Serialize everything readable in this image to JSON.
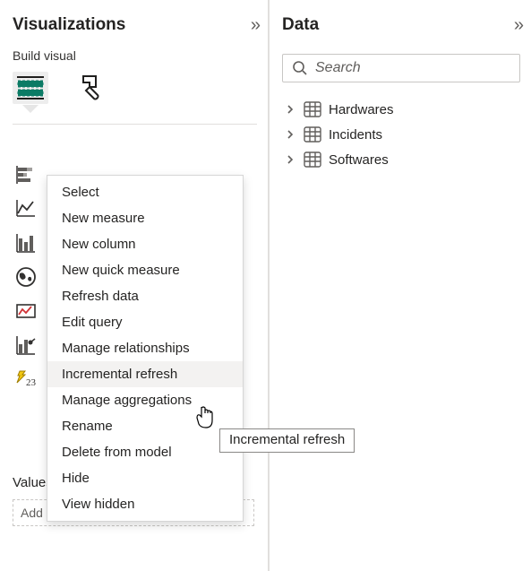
{
  "viz": {
    "title": "Visualizations",
    "collapse_glyph": "»",
    "build_visual_label": "Build visual",
    "fields_label": "Values",
    "fields_placeholder": "Add data fields here"
  },
  "context_menu": {
    "items": [
      {
        "label": "Select",
        "hover": false
      },
      {
        "label": "New measure",
        "hover": false
      },
      {
        "label": "New column",
        "hover": false
      },
      {
        "label": "New quick measure",
        "hover": false
      },
      {
        "label": "Refresh data",
        "hover": false
      },
      {
        "label": "Edit query",
        "hover": false
      },
      {
        "label": "Manage relationships",
        "hover": false
      },
      {
        "label": "Incremental refresh",
        "hover": true
      },
      {
        "label": "Manage aggregations",
        "hover": false
      },
      {
        "label": "Rename",
        "hover": false
      },
      {
        "label": "Delete from model",
        "hover": false
      },
      {
        "label": "Hide",
        "hover": false
      },
      {
        "label": "View hidden",
        "hover": false
      }
    ]
  },
  "tooltip_text": "Incremental refresh",
  "data": {
    "title": "Data",
    "collapse_glyph": "»",
    "search_placeholder": "Search",
    "tables": [
      {
        "name": "Hardwares"
      },
      {
        "name": "Incidents"
      },
      {
        "name": "Softwares"
      }
    ]
  }
}
